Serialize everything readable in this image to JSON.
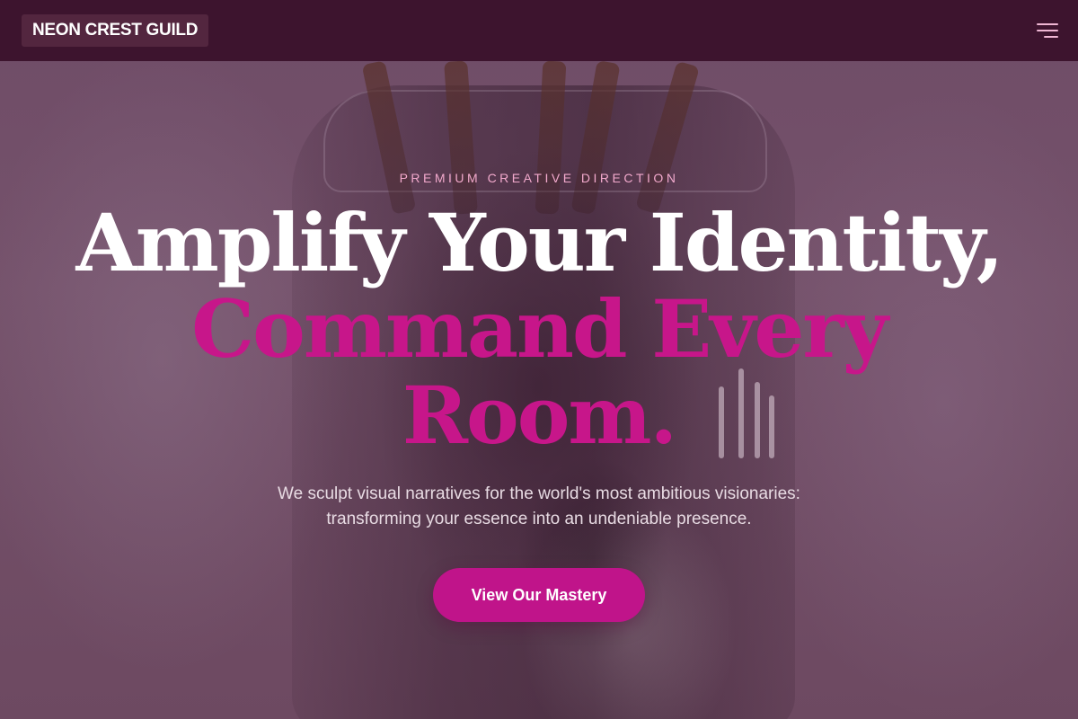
{
  "navbar": {
    "brand": "NEON CREST GUILD",
    "menu_icon": "hamburger-menu-icon"
  },
  "hero": {
    "eyebrow": "PREMIUM CREATIVE DIRECTION",
    "headline_line1": "Amplify Your Identity,",
    "headline_line2": "Command Every",
    "headline_line3": "Room.",
    "subtitle_line1": "We sculpt visual narratives for the world's most ambitious visionaries:",
    "subtitle_line2": "transforming your essence into an undeniable presence.",
    "cta_label": "View Our Mastery"
  },
  "colors": {
    "navbar_bg": "#3d142e",
    "accent_pink": "#c7168a",
    "eyebrow_pink": "#f2a9cc",
    "headline_white": "#ffffff",
    "overlay": "#6e4a63"
  }
}
